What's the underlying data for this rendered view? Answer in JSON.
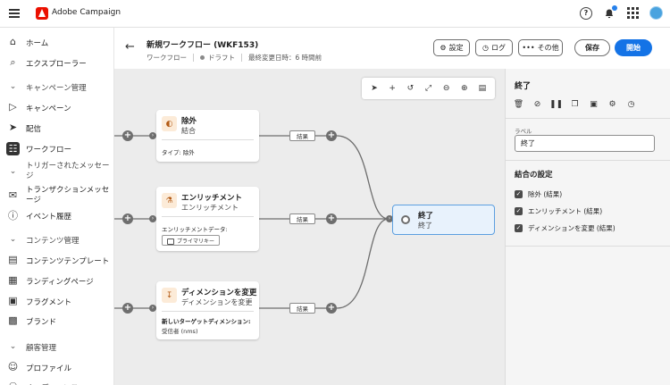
{
  "app": {
    "brand": "Adobe Campaign"
  },
  "sidebar": {
    "items": [
      {
        "label": "ホーム",
        "icon": "home-icon"
      },
      {
        "label": "エクスプローラー",
        "icon": "explorer-icon"
      },
      {
        "label": "キャンペーン管理",
        "icon": "chevron-down-icon",
        "section": true
      },
      {
        "label": "キャンペーン",
        "icon": "megaphone-icon"
      },
      {
        "label": "配信",
        "icon": "send-icon"
      },
      {
        "label": "ワークフロー",
        "icon": "workflow-icon",
        "active": true
      },
      {
        "label": "トリガーされたメッセージ",
        "icon": "chevron-down-icon",
        "section": true
      },
      {
        "label": "トランザクションメッセージ",
        "icon": "transaction-icon"
      },
      {
        "label": "イベント履歴",
        "icon": "history-icon"
      },
      {
        "label": "コンテンツ管理",
        "icon": "chevron-down-icon",
        "section": true
      },
      {
        "label": "コンテンツテンプレート",
        "icon": "template-icon"
      },
      {
        "label": "ランディングページ",
        "icon": "landing-page-icon"
      },
      {
        "label": "フラグメント",
        "icon": "fragment-icon"
      },
      {
        "label": "ブランド",
        "icon": "brand-icon"
      },
      {
        "label": "顧客管理",
        "icon": "chevron-down-icon",
        "section": true
      },
      {
        "label": "プロファイル",
        "icon": "profile-icon"
      },
      {
        "label": "オーディエンス",
        "icon": "audience-icon"
      }
    ]
  },
  "header": {
    "title": "新規ワークフロー (WKF153)",
    "type": "ワークフロー",
    "status": "ドラフト",
    "modified": "最終変更日時：6 時間前",
    "settings_label": "設定",
    "log_label": "ログ",
    "more_label": "その他",
    "save_label": "保存",
    "start_label": "開始"
  },
  "nodes": {
    "exclusion": {
      "title": "除外",
      "subtitle": "結合",
      "meta": "タイプ: 除外"
    },
    "enrichment": {
      "title": "エンリッチメント",
      "subtitle": "エンリッチメント",
      "meta": "エンリッチメントデータ:",
      "chip": "プライマリキー"
    },
    "dimension": {
      "title": "ディメンションを変更",
      "subtitle": "ディメンションを変更",
      "meta": "新しいターゲットディメンション:",
      "value": "受信者 (nms)"
    },
    "end": {
      "title": "終了",
      "subtitle": "終了"
    },
    "result_label": "結果"
  },
  "panel": {
    "title": "終了",
    "label_caption": "ラベル",
    "label_value": "終了",
    "section_title": "結合の設定",
    "options": [
      {
        "label": "除外 (結果)",
        "checked": true
      },
      {
        "label": "エンリッチメント (結果)",
        "checked": true
      },
      {
        "label": "ディメンションを変更 (結果)",
        "checked": true
      }
    ]
  },
  "colors": {
    "accent": "#1473e6",
    "selected_border": "#5c9fe0",
    "brand": "#eb1000"
  }
}
